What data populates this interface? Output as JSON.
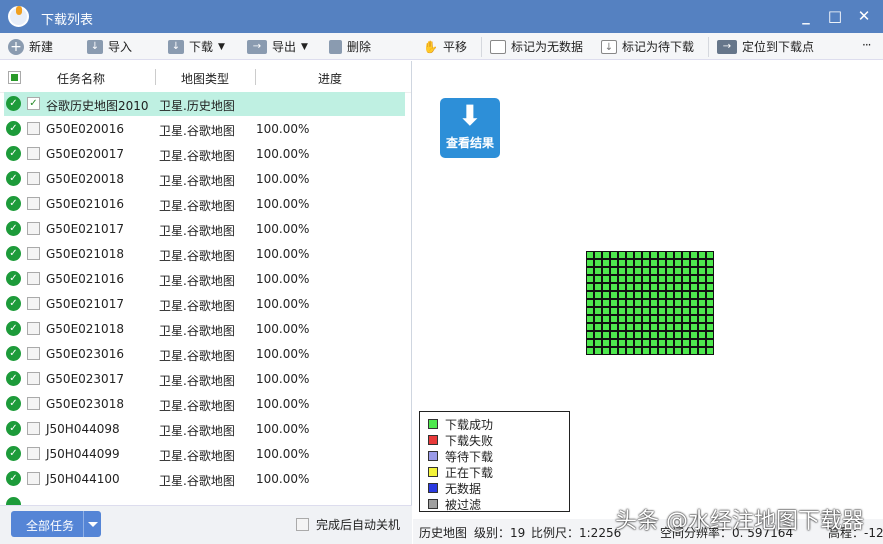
{
  "window": {
    "title": "下载列表",
    "minimize": "_",
    "maximize": "□",
    "close": "✕"
  },
  "toolbar": {
    "new": "新建",
    "import": "导入",
    "download": "下载",
    "export": "导出",
    "delete": "删除",
    "pan": "平移",
    "mark_nodata": "标记为无数据",
    "mark_pending": "标记为待下载",
    "locate": "定位到下载点",
    "more": "···"
  },
  "table": {
    "headers": [
      "任务名称",
      "地图类型",
      "进度"
    ],
    "rows": [
      {
        "name": "谷歌历史地图2010",
        "type": "卫星.历史地图",
        "progress": "",
        "checked": true
      },
      {
        "name": "G50E020016",
        "type": "卫星.谷歌地图",
        "progress": "100.00%"
      },
      {
        "name": "G50E020017",
        "type": "卫星.谷歌地图",
        "progress": "100.00%"
      },
      {
        "name": "G50E020018",
        "type": "卫星.谷歌地图",
        "progress": "100.00%"
      },
      {
        "name": "G50E021016",
        "type": "卫星.谷歌地图",
        "progress": "100.00%"
      },
      {
        "name": "G50E021017",
        "type": "卫星.谷歌地图",
        "progress": "100.00%"
      },
      {
        "name": "G50E021018",
        "type": "卫星.谷歌地图",
        "progress": "100.00%"
      },
      {
        "name": "G50E021016",
        "type": "卫星.谷歌地图",
        "progress": "100.00%"
      },
      {
        "name": "G50E021017",
        "type": "卫星.谷歌地图",
        "progress": "100.00%"
      },
      {
        "name": "G50E021018",
        "type": "卫星.谷歌地图",
        "progress": "100.00%"
      },
      {
        "name": "G50E023016",
        "type": "卫星.谷歌地图",
        "progress": "100.00%"
      },
      {
        "name": "G50E023017",
        "type": "卫星.谷歌地图",
        "progress": "100.00%"
      },
      {
        "name": "G50E023018",
        "type": "卫星.谷歌地图",
        "progress": "100.00%"
      },
      {
        "name": "J50H044098",
        "type": "卫星.谷歌地图",
        "progress": "100.00%"
      },
      {
        "name": "J50H044099",
        "type": "卫星.谷歌地图",
        "progress": "100.00%"
      },
      {
        "name": "J50H044100",
        "type": "卫星.谷歌地图",
        "progress": "100.00%"
      }
    ]
  },
  "bottom": {
    "all_tasks": "全部任务",
    "auto_shutdown": "完成后自动关机"
  },
  "map": {
    "view_result": "查看结果",
    "tile_grid": {
      "cols": 16,
      "rows": 13,
      "status": "下载成功"
    }
  },
  "legend": [
    {
      "label": "下载成功",
      "color": "#4ee84e"
    },
    {
      "label": "下载失败",
      "color": "#e83a3a"
    },
    {
      "label": "等待下载",
      "color": "#9a9ae8"
    },
    {
      "label": "正在下载",
      "color": "#f4f43a"
    },
    {
      "label": "无数据",
      "color": "#2a3ae0"
    },
    {
      "label": "被过滤",
      "color": "#a0a0a0"
    }
  ],
  "status": {
    "map": "历史地图",
    "level": "级别：19",
    "scale": "比例尺：1:2256",
    "resolution": "空间分辨率：0. 597164",
    "elevation": "高程：-12"
  },
  "watermark": "头条 @水经注地图下载器"
}
